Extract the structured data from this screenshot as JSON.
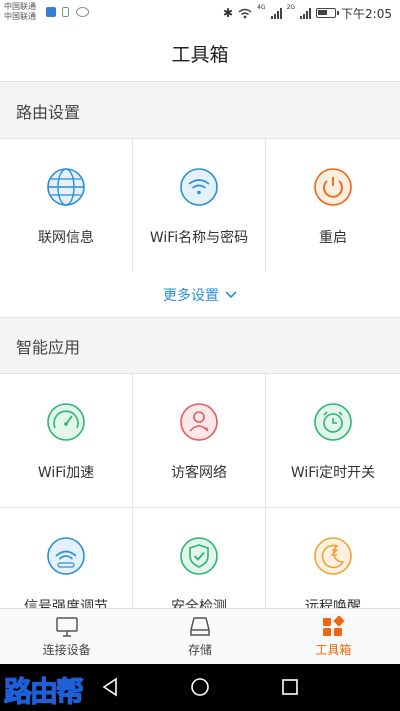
{
  "status_bar": {
    "carrier_1": "中国联通",
    "carrier_2": "中国联通",
    "net_1": "4G",
    "net_2": "2G",
    "time": "下午2:05"
  },
  "header": {
    "title": "工具箱"
  },
  "router_settings": {
    "title": "路由设置",
    "items": [
      {
        "label": "联网信息",
        "icon": "globe-icon",
        "color": "#2a8fd6"
      },
      {
        "label": "WiFi名称与密码",
        "icon": "wifi-icon",
        "color": "#2a8fd6"
      },
      {
        "label": "重启",
        "icon": "power-icon",
        "color": "#f2650f"
      }
    ],
    "more_label": "更多设置"
  },
  "smart_apps": {
    "title": "智能应用",
    "items": [
      {
        "label": "WiFi加速",
        "icon": "speedometer-icon",
        "color": "#2bb673"
      },
      {
        "label": "访客网络",
        "icon": "guest-user-icon",
        "color": "#e85a5a"
      },
      {
        "label": "WiFi定时开关",
        "icon": "alarm-clock-icon",
        "color": "#2bb673"
      },
      {
        "label": "信号强度调节",
        "icon": "signal-wifi-icon",
        "color": "#2a8fd6"
      },
      {
        "label": "安全检测",
        "icon": "shield-check-icon",
        "color": "#2bb673"
      },
      {
        "label": "远程唤醒",
        "icon": "moon-sleep-icon",
        "color": "#f2a13a"
      }
    ]
  },
  "tabbar": {
    "tabs": [
      {
        "label": "连接设备",
        "icon": "monitor-icon",
        "active": false
      },
      {
        "label": "存储",
        "icon": "drive-icon",
        "active": false
      },
      {
        "label": "工具箱",
        "icon": "toolbox-icon",
        "active": true
      }
    ],
    "active_color": "#f2650f"
  },
  "watermark": {
    "text": "路由帮"
  }
}
